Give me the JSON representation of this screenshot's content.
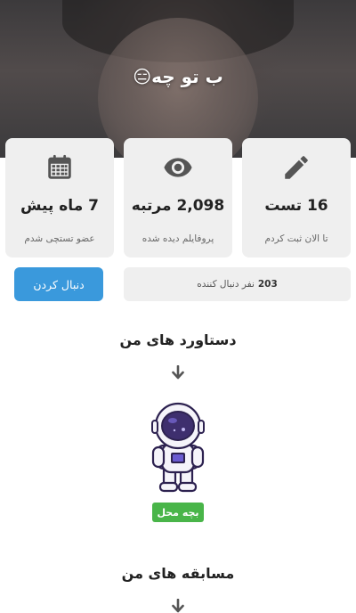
{
  "profile": {
    "name": "ب تو چه😑"
  },
  "stats": [
    {
      "icon": "pencil-icon",
      "value": "16 تست",
      "label": "تا الان ثبت کردم"
    },
    {
      "icon": "eye-icon",
      "value": "2,098 مرتبه",
      "label": "پروفایلم دیده شده"
    },
    {
      "icon": "calendar-icon",
      "value": "7 ماه پیش",
      "label": "عضو تستچی شدم"
    }
  ],
  "follow": {
    "button_label": "دنبال کردن",
    "followers_count": "203",
    "followers_suffix": "نفر دنبال کننده"
  },
  "achievements": {
    "title": "دستاورد های من",
    "badge_label": "بچه محل",
    "badge_icon": "astronaut-icon"
  },
  "competitions": {
    "title": "مسابقه های من"
  },
  "colors": {
    "primary": "#3a99dc",
    "badge_green": "#49b549",
    "card_bg": "#efefef",
    "icon_gray": "#555555"
  }
}
